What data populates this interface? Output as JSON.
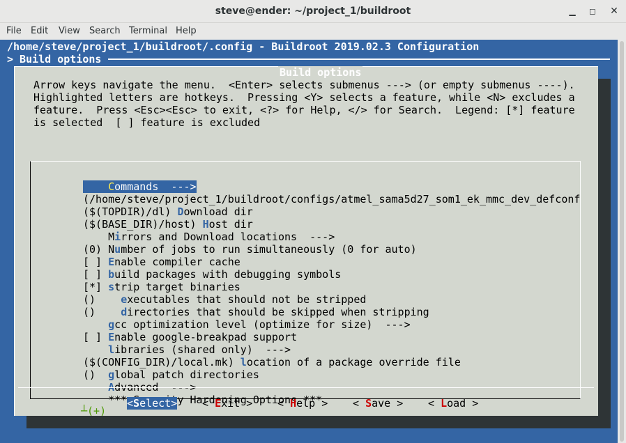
{
  "window": {
    "title": "steve@ender: ~/project_1/buildroot"
  },
  "menubar": [
    "File",
    "Edit",
    "View",
    "Search",
    "Terminal",
    "Help"
  ],
  "terminal": {
    "header_line1": "/home/steve/project_1/buildroot/.config - Buildroot 2019.02.3 Configuration",
    "header_line2": "> Build options",
    "dialog_title": "Build options",
    "help_lines": [
      "Arrow keys navigate the menu.  <Enter> selects submenus ---> (or empty submenus ----).",
      "Highlighted letters are hotkeys.  Pressing <Y> selects a feature, while <N> excludes a",
      "feature.  Press <Esc><Esc> to exit, <?> for Help, </> for Search.  Legend: [*] feature",
      "is selected  [ ] feature is excluded"
    ],
    "items": [
      {
        "pre": "    ",
        "hot": "C",
        "post": "ommands  --->",
        "selected": true
      },
      {
        "pre": "(/home/steve/project_1/buildroot/configs/atmel_sama5d27_som1_ek_mmc_dev_defconf",
        "hot": "",
        "post": ""
      },
      {
        "pre": "($(TOPDIR)/dl) ",
        "hot": "D",
        "post": "ownload dir"
      },
      {
        "pre": "($(BASE_DIR)/host) ",
        "hot": "H",
        "post": "ost dir"
      },
      {
        "pre": "    M",
        "hot": "i",
        "post": "rrors and Download locations  --->"
      },
      {
        "pre": "(0) N",
        "hot": "u",
        "post": "mber of jobs to run simultaneously (0 for auto)"
      },
      {
        "pre": "[ ] ",
        "hot": "E",
        "post": "nable compiler cache"
      },
      {
        "pre": "[ ] ",
        "hot": "b",
        "post": "uild packages with debugging symbols"
      },
      {
        "pre": "[*] ",
        "hot": "s",
        "post": "trip target binaries"
      },
      {
        "pre": "()    ",
        "hot": "e",
        "post": "xecutables that should not be stripped"
      },
      {
        "pre": "()    ",
        "hot": "d",
        "post": "irectories that should be skipped when stripping"
      },
      {
        "pre": "    ",
        "hot": "g",
        "post": "cc optimization level (optimize for size)  --->"
      },
      {
        "pre": "[ ] ",
        "hot": "E",
        "post": "nable google-breakpad support"
      },
      {
        "pre": "    ",
        "hot": "l",
        "post": "ibraries (shared only)  --->"
      },
      {
        "pre": "($(CONFIG_DIR)/local.mk) ",
        "hot": "l",
        "post": "ocation of a package override file"
      },
      {
        "pre": "()  ",
        "hot": "g",
        "post": "lobal patch directories"
      },
      {
        "pre": "    ",
        "hot": "A",
        "post": "dvanced  --->"
      },
      {
        "pre": "    *** Security Hardening Options ***",
        "hot": "",
        "post": ""
      }
    ],
    "more_indicator": "┴(+)",
    "buttons": [
      {
        "pre": "<",
        "hot": "S",
        "post": "elect>",
        "selected": true
      },
      {
        "pre": "< ",
        "hot": "E",
        "post": "xit >"
      },
      {
        "pre": "< ",
        "hot": "H",
        "post": "elp >"
      },
      {
        "pre": "< ",
        "hot": "S",
        "post": "ave >"
      },
      {
        "pre": "< ",
        "hot": "L",
        "post": "oad >"
      }
    ]
  },
  "colors": {
    "terminal_bg": "#3465a4",
    "dialog_bg": "#d3d7cf",
    "hotkey": "#3465a4",
    "button_hotkey": "#cc0000"
  }
}
